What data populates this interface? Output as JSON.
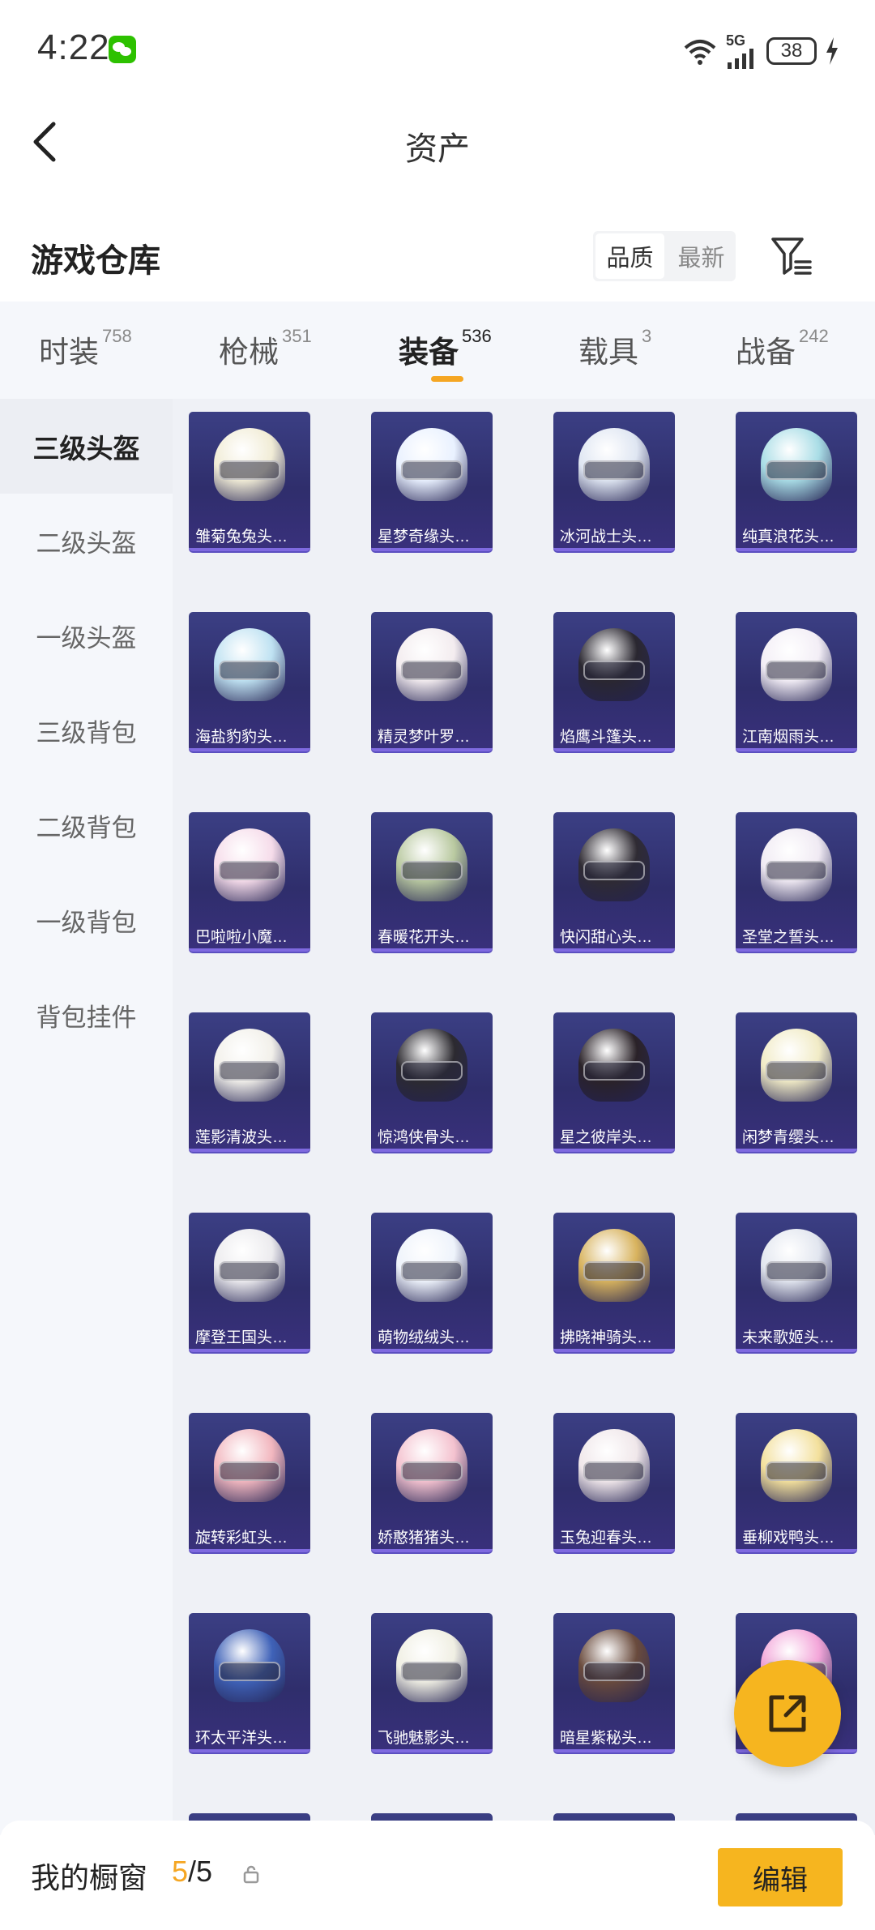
{
  "status_bar": {
    "time": "4:22",
    "network": "5G",
    "battery": "38"
  },
  "header": {
    "title": "资产"
  },
  "warehouse": {
    "title": "游戏仓库",
    "sort_options": [
      "品质",
      "最新"
    ]
  },
  "tabs": [
    {
      "label": "时装",
      "count": "758"
    },
    {
      "label": "枪械",
      "count": "351"
    },
    {
      "label": "装备",
      "count": "536"
    },
    {
      "label": "载具",
      "count": "3"
    },
    {
      "label": "战备",
      "count": "242"
    }
  ],
  "sidebar": {
    "items": [
      "三级头盔",
      "二级头盔",
      "一级头盔",
      "三级背包",
      "二级背包",
      "一级背包",
      "背包挂件"
    ]
  },
  "items": [
    [
      "雏菊兔兔头…",
      "星梦奇缘头…",
      "冰河战士头…",
      "纯真浪花头…"
    ],
    [
      "海盐豹豹头…",
      "精灵梦叶罗…",
      "焰鹰斗篷头…",
      "江南烟雨头…"
    ],
    [
      "巴啦啦小魔…",
      "春暖花开头…",
      "快闪甜心头…",
      "圣堂之誓头…"
    ],
    [
      "莲影清波头…",
      "惊鸿侠骨头…",
      "星之彼岸头…",
      "闲梦青缨头…"
    ],
    [
      "摩登王国头…",
      "萌物绒绒头…",
      "拂晓神骑头…",
      "未来歌姬头…"
    ],
    [
      "旋转彩虹头…",
      "娇憨猪猪头…",
      "玉兔迎春头…",
      "垂柳戏鸭头…"
    ],
    [
      "环太平洋头…",
      "飞驰魅影头…",
      "暗星紫秘头…",
      ""
    ]
  ],
  "bottom": {
    "showcase_label": "我的橱窗",
    "count_current": "5",
    "count_total": "/5",
    "edit_label": "编辑"
  }
}
